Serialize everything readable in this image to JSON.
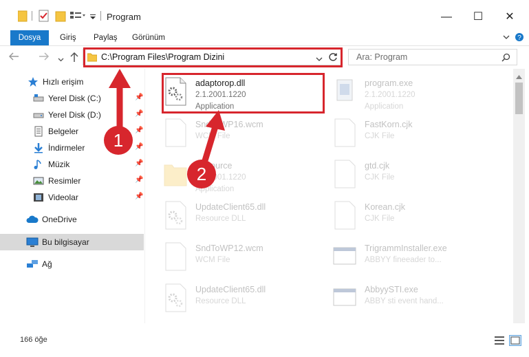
{
  "window": {
    "title": "Program",
    "minimize_glyph": "—",
    "maximize_glyph": "☐",
    "close_glyph": "✕"
  },
  "ribbon": {
    "tabs": [
      {
        "label": "Dosya",
        "active": true
      },
      {
        "label": "Giriş"
      },
      {
        "label": "Paylaş"
      },
      {
        "label": "Görünüm"
      }
    ]
  },
  "nav": {
    "address": "C:\\Program Files\\Program Dizini",
    "search_placeholder": "Ara: Program"
  },
  "sidebar": {
    "items": [
      {
        "label": "Hızlı erişim",
        "icon": "star-icon"
      },
      {
        "label": "Yerel Disk (C:)",
        "icon": "drive-icon",
        "pinned": true
      },
      {
        "label": "Yerel Disk (D:)",
        "icon": "drive-icon",
        "pinned": true
      },
      {
        "label": "Belgeler",
        "icon": "documents-icon",
        "pinned": true
      },
      {
        "label": "İndirmeler",
        "icon": "download-icon",
        "pinned": true
      },
      {
        "label": "Müzik",
        "icon": "music-icon",
        "pinned": true
      },
      {
        "label": "Resimler",
        "icon": "pictures-icon",
        "pinned": true
      },
      {
        "label": "Videolar",
        "icon": "videos-icon",
        "pinned": true
      },
      {
        "label": "OneDrive",
        "icon": "cloud-icon"
      },
      {
        "label": "Bu bilgisayar",
        "icon": "computer-icon",
        "selected": true
      },
      {
        "label": "Ağ",
        "icon": "network-icon"
      }
    ]
  },
  "files": [
    {
      "name": "adaptorop.dll",
      "line2": "2.1.2001.1220",
      "line3": "Application",
      "icon": "dll-gear-icon",
      "highlighted": true
    },
    {
      "name": "program.exe",
      "line2": "2.1.2001.1220",
      "line3": "Application",
      "icon": "exe-icon"
    },
    {
      "name": "SndToWP16.wcm",
      "line2": "WCM File",
      "icon": "blank-file-icon"
    },
    {
      "name": "FastKorn.cjk",
      "line2": "CJK File",
      "icon": "blank-file-icon"
    },
    {
      "name": "Resource",
      "line2": "2.1.2001.1220",
      "line3": "Application",
      "icon": "folder-icon"
    },
    {
      "name": "gtd.cjk",
      "line2": "CJK File",
      "icon": "blank-file-icon"
    },
    {
      "name": "UpdateClient65.dll",
      "line2": "Resource DLL",
      "icon": "dll-gear-icon"
    },
    {
      "name": "Korean.cjk",
      "line2": "CJK File",
      "icon": "blank-file-icon"
    },
    {
      "name": "SndToWP12.wcm",
      "line2": "WCM File",
      "icon": "blank-file-icon"
    },
    {
      "name": "TrigrammInstaller.exe",
      "line2": "ABBYY fineeader to...",
      "icon": "window-exe-icon"
    },
    {
      "name": "UpdateClient65.dll",
      "line2": "Resource DLL",
      "icon": "dll-gear-icon"
    },
    {
      "name": "AbbyySTI.exe",
      "line2": "ABBY sti event hand...",
      "icon": "window-exe-icon"
    }
  ],
  "status": {
    "item_count": "166 öğe"
  },
  "callouts": {
    "one": "1",
    "two": "2"
  },
  "colors": {
    "accent": "#1979ca",
    "highlight": "#d7262d",
    "folder": "#f5c542"
  }
}
